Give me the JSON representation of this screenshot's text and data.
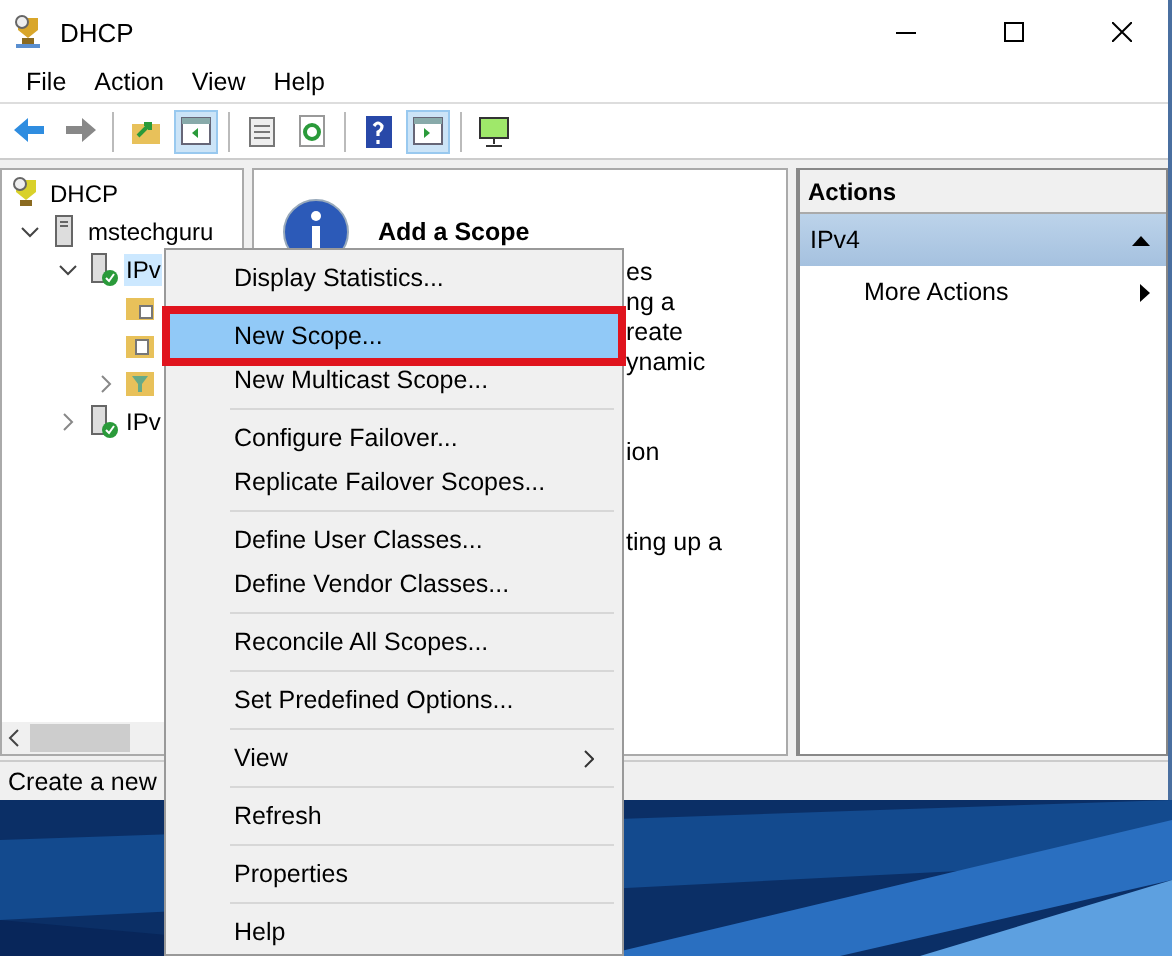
{
  "window": {
    "title": "DHCP"
  },
  "menu_bar": [
    {
      "label": "File"
    },
    {
      "label": "Action"
    },
    {
      "label": "View"
    },
    {
      "label": "Help"
    }
  ],
  "toolbar": [
    {
      "kind": "back",
      "pressed": false
    },
    {
      "kind": "forward",
      "pressed": false
    },
    {
      "kind": "sep"
    },
    {
      "kind": "up",
      "pressed": false
    },
    {
      "kind": "pane",
      "pressed": true
    },
    {
      "kind": "sep"
    },
    {
      "kind": "list",
      "pressed": false
    },
    {
      "kind": "refresh",
      "pressed": false
    },
    {
      "kind": "sep"
    },
    {
      "kind": "help",
      "pressed": false
    },
    {
      "kind": "pane2",
      "pressed": true
    },
    {
      "kind": "sep"
    },
    {
      "kind": "monitor",
      "pressed": false
    }
  ],
  "tree": [
    {
      "label": "DHCP",
      "kind": "dhcp",
      "children": [
        {
          "label": "mstechguru",
          "kind": "server",
          "expanded": true,
          "selected": false,
          "children": [
            {
              "label": "IPv",
              "kind": "ipv",
              "expanded": true,
              "selected": true,
              "children": [
                {
                  "kind": "folder-grid"
                },
                {
                  "kind": "folder-doc"
                },
                {
                  "kind": "filter",
                  "expanded": false
                }
              ]
            },
            {
              "label": "IPv",
              "kind": "ipv",
              "expanded": false,
              "selected": false
            }
          ]
        }
      ]
    }
  ],
  "center": {
    "title": "Add a Scope",
    "paragraphs": [
      [
        "es",
        "ng a",
        "reate",
        "ynamic"
      ],
      [
        "ion"
      ],
      [
        "ting up a"
      ]
    ]
  },
  "actions": {
    "title": "Actions",
    "sections": [
      {
        "label": "IPv4",
        "expanded": true,
        "items": [
          {
            "label": "More Actions",
            "submenu": true
          }
        ]
      }
    ]
  },
  "status_bar": {
    "text": "Create a new"
  },
  "context_menu": {
    "groups": [
      [
        {
          "label": "Display Statistics...",
          "selected": false,
          "outlined": false
        }
      ],
      [
        {
          "label": "New Scope...",
          "selected": true,
          "outlined": true
        },
        {
          "label": "New Multicast Scope...",
          "selected": false,
          "outlined": false
        }
      ],
      [
        {
          "label": "Configure Failover...",
          "selected": false,
          "outlined": false
        },
        {
          "label": "Replicate Failover Scopes...",
          "selected": false,
          "outlined": false
        }
      ],
      [
        {
          "label": "Define User Classes...",
          "selected": false,
          "outlined": false
        },
        {
          "label": "Define Vendor Classes...",
          "selected": false,
          "outlined": false
        }
      ],
      [
        {
          "label": "Reconcile All Scopes...",
          "selected": false,
          "outlined": false
        }
      ],
      [
        {
          "label": "Set Predefined Options...",
          "selected": false,
          "outlined": false
        }
      ],
      [
        {
          "label": "View",
          "selected": false,
          "outlined": false,
          "submenu": true
        }
      ],
      [
        {
          "label": "Refresh",
          "selected": false,
          "outlined": false
        }
      ],
      [
        {
          "label": "Properties",
          "selected": false,
          "outlined": false
        }
      ],
      [
        {
          "label": "Help",
          "selected": false,
          "outlined": false
        }
      ]
    ]
  }
}
